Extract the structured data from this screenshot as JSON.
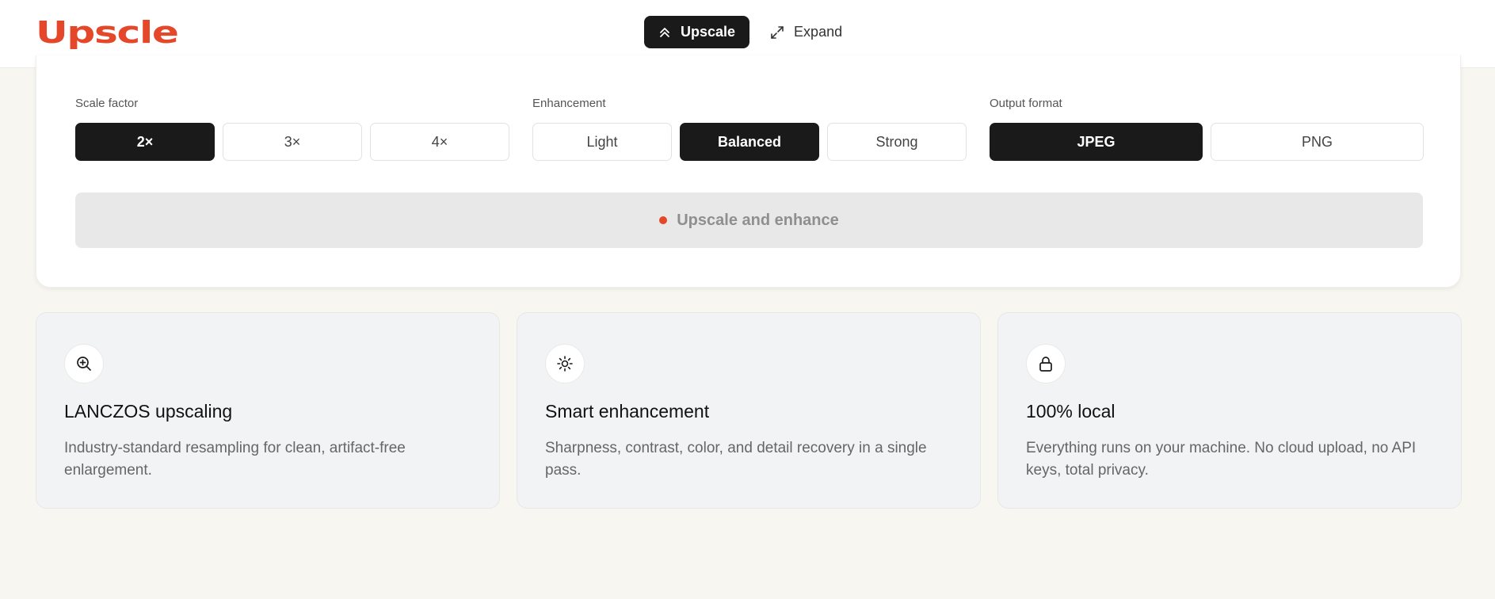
{
  "app": {
    "logo_text": "Upscle",
    "brand_color": "#e4472a"
  },
  "nav": {
    "upscale_label": "Upscale",
    "expand_label": "Expand",
    "active_tab": "Upscale"
  },
  "settings": {
    "scale": {
      "label": "Scale factor",
      "options": [
        "2×",
        "3×",
        "4×"
      ],
      "selected": "2×"
    },
    "enhancement": {
      "label": "Enhancement",
      "options": [
        "Light",
        "Balanced",
        "Strong"
      ],
      "selected": "Balanced"
    },
    "format": {
      "label": "Output format",
      "options": [
        "JPEG",
        "PNG"
      ],
      "selected": "JPEG"
    },
    "run_label": "Upscale and enhance"
  },
  "features": [
    {
      "icon": "zoom-in-icon",
      "title": "LANCZOS upscaling",
      "desc": "Industry-standard resampling for clean, artifact-free enlargement."
    },
    {
      "icon": "sun-icon",
      "title": "Smart enhancement",
      "desc": "Sharpness, contrast, color, and detail recovery in a single pass."
    },
    {
      "icon": "lock-icon",
      "title": "100% local",
      "desc": "Everything runs on your machine. No cloud upload, no API keys, total privacy."
    }
  ]
}
